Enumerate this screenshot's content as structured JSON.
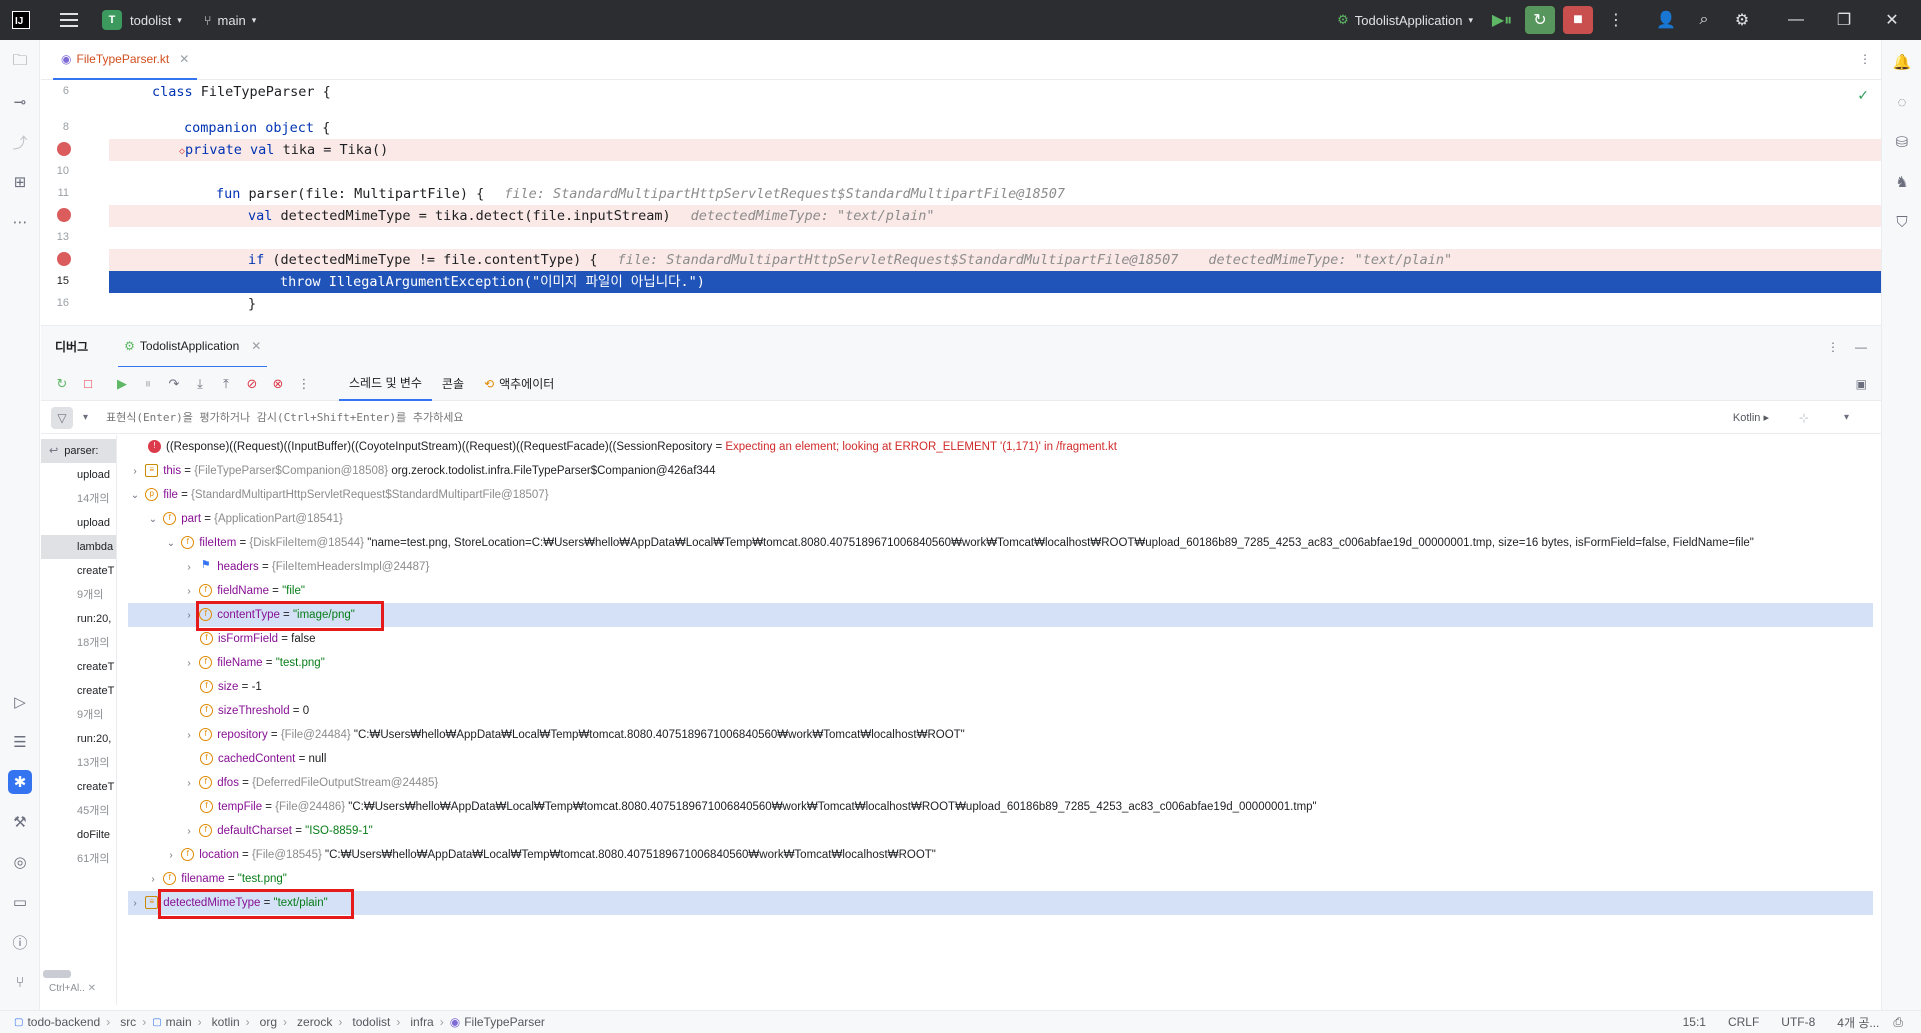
{
  "titlebar": {
    "project_letter": "T",
    "project": "todolist",
    "branch": "main",
    "run_config": "TodolistApplication"
  },
  "editor": {
    "tab_file": "FileTypeParser.kt",
    "lines": [
      {
        "num": "6",
        "code_kw": "class",
        "code_rest": " FileTypeParser {"
      },
      {
        "num": "8",
        "code_kw": "companion object",
        "code_rest": " {"
      },
      {
        "num": "9",
        "code_kw": "private val",
        "code_rest": " tika = Tika()"
      },
      {
        "num": "10",
        "code": ""
      },
      {
        "num": "11",
        "code_kw": "fun",
        "code_rest": " parser(file: MultipartFile) {",
        "inlay": "file: StandardMultipartHttpServletRequest$StandardMultipartFile@18507"
      },
      {
        "num": "12",
        "code_kw": "val",
        "code_rest": " detectedMimeType = tika.detect(file.inputStream)",
        "inlay": "detectedMimeType: \"text/plain\""
      },
      {
        "num": "13",
        "code": ""
      },
      {
        "num": "14",
        "code_kw": "if",
        "code_rest": " (detectedMimeType != file.contentType) {",
        "inlay": "file: StandardMultipartHttpServletRequest$StandardMultipartFile@18507",
        "inlay2": "detectedMimeType: \"text/plain\""
      },
      {
        "num": "15",
        "code": "throw IllegalArgumentException(\"이미지 파일이 아닙니다.\")"
      },
      {
        "num": "16",
        "code": "}"
      }
    ]
  },
  "debug": {
    "title": "디버그",
    "session_tab": "TodolistApplication",
    "tabs": [
      "스레드 및 변수",
      "콘솔",
      "액추에이터"
    ],
    "eval_placeholder": "표현식(Enter)을 평가하거나 감시(Ctrl+Shift+Enter)를 추가하세요",
    "lang": "Kotlin",
    "frames": [
      "parser:",
      "upload",
      "14개의",
      "upload",
      "lambda",
      "createT",
      "9개의",
      "run:20,",
      "18개의",
      "createT",
      "createT",
      "9개의",
      "run:20,",
      "13개의",
      "createT",
      "45개의",
      "doFilte",
      "61개의"
    ],
    "frames_footer": "Ctrl+Al..",
    "vars": [
      {
        "name": "",
        "text": "((Response)((Request)((InputBuffer)((CoyoteInputStream)((Request)((RequestFacade)((SessionRepository = ",
        "err": "Expecting an element; looking at ERROR_ELEMENT '(1,171)' in /fragment.kt"
      },
      {
        "name": "this",
        "type": "{FileTypeParser$Companion@18508}",
        "value": "org.zerock.todolist.infra.FileTypeParser$Companion@426af344"
      },
      {
        "name": "file",
        "type": "{StandardMultipartHttpServletRequest$StandardMultipartFile@18507}",
        "value": ""
      },
      {
        "name": "part",
        "type": "{ApplicationPart@18541}",
        "value": ""
      },
      {
        "name": "fileItem",
        "type": "{DiskFileItem@18544}",
        "value": "\"name=test.png, StoreLocation=C:₩Users₩hello₩AppData₩Local₩Temp₩tomcat.8080.4075189671006840560₩work₩Tomcat₩localhost₩ROOT₩upload_60186b89_7285_4253_ac83_c006abfae19d_00000001.tmp, size=16 bytes, isFormField=false, FieldName=file\""
      },
      {
        "name": "headers",
        "type": "{FileItemHeadersImpl@24487}",
        "value": ""
      },
      {
        "name": "fieldName",
        "type": "",
        "value": "\"file\""
      },
      {
        "name": "contentType",
        "type": "",
        "value": "\"image/png\""
      },
      {
        "name": "isFormField",
        "type": "",
        "value": "false"
      },
      {
        "name": "fileName",
        "type": "",
        "value": "\"test.png\""
      },
      {
        "name": "size",
        "type": "",
        "value": "-1"
      },
      {
        "name": "sizeThreshold",
        "type": "",
        "value": "0"
      },
      {
        "name": "repository",
        "type": "{File@24484}",
        "value": "\"C:₩Users₩hello₩AppData₩Local₩Temp₩tomcat.8080.4075189671006840560₩work₩Tomcat₩localhost₩ROOT\""
      },
      {
        "name": "cachedContent",
        "type": "",
        "value": "null"
      },
      {
        "name": "dfos",
        "type": "{DeferredFileOutputStream@24485}",
        "value": ""
      },
      {
        "name": "tempFile",
        "type": "{File@24486}",
        "value": "\"C:₩Users₩hello₩AppData₩Local₩Temp₩tomcat.8080.4075189671006840560₩work₩Tomcat₩localhost₩ROOT₩upload_60186b89_7285_4253_ac83_c006abfae19d_00000001.tmp\""
      },
      {
        "name": "defaultCharset",
        "type": "",
        "value": "\"ISO-8859-1\""
      },
      {
        "name": "location",
        "type": "{File@18545}",
        "value": "\"C:₩Users₩hello₩AppData₩Local₩Temp₩tomcat.8080.4075189671006840560₩work₩Tomcat₩localhost₩ROOT\""
      },
      {
        "name": "filename",
        "type": "",
        "value": "\"test.png\""
      },
      {
        "name": "detectedMimeType",
        "type": "",
        "value": "\"text/plain\""
      }
    ]
  },
  "status": {
    "crumbs": [
      "todo-backend",
      "src",
      "main",
      "kotlin",
      "org",
      "zerock",
      "todolist",
      "infra",
      "FileTypeParser"
    ],
    "position": "15:1",
    "line_sep": "CRLF",
    "encoding": "UTF-8",
    "indent": "4개 공..."
  },
  "colors": {
    "accent": "#3574f0",
    "breakpoint": "#db5c5c",
    "exec_line": "#2154b8",
    "annotation_box": "#e51b1b"
  }
}
